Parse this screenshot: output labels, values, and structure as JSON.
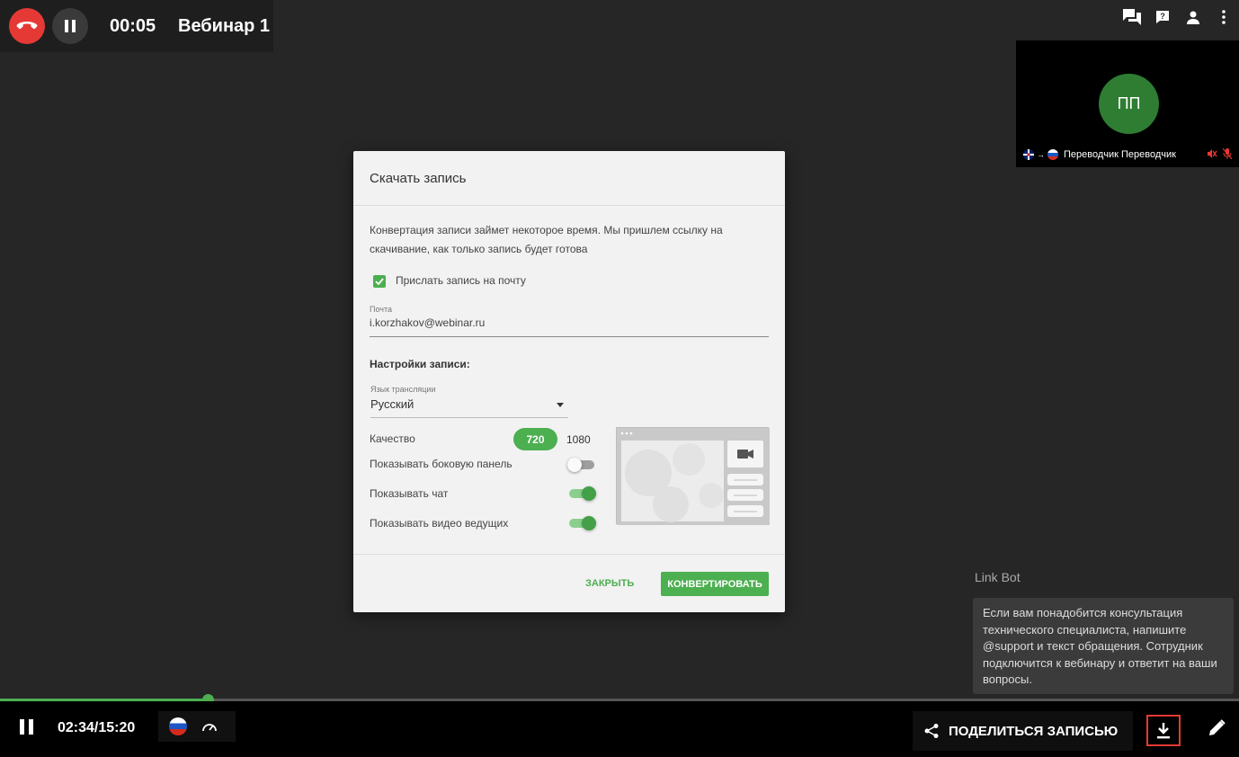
{
  "top_bar": {
    "timer": "00:05",
    "webinar_title": "Вебинар 1"
  },
  "participant_tile": {
    "initials": "ПП",
    "name": "Переводчик Переводчик",
    "lang_from": "en",
    "lang_to": "ru",
    "icon_names": [
      "speaker-muted-icon",
      "mic-muted-icon"
    ]
  },
  "dialog": {
    "title": "Скачать запись",
    "description": "Конвертация записи займет некоторое время. Мы пришлем ссылку на скачивание, как только запись будет готова",
    "send_email_label": "Прислать запись на почту",
    "send_email_checked": true,
    "email_label": "Почта",
    "email_value": "i.korzhakov@webinar.ru",
    "settings_title": "Настройки записи:",
    "language_label": "Язык трансляции",
    "language_value": "Русский",
    "quality_label": "Качество",
    "quality_options": [
      "720",
      "1080"
    ],
    "quality_selected": "720",
    "toggles": [
      {
        "label": "Показывать боковую панель",
        "on": false
      },
      {
        "label": "Показывать чат",
        "on": true
      },
      {
        "label": "Показывать видео ведущих",
        "on": true
      }
    ],
    "close_label": "ЗАКРЫТЬ",
    "convert_label": "КОНВЕРТИРОВАТЬ"
  },
  "chat": {
    "bot_name": "Link Bot",
    "message": "Если вам понадобится консультация технического специалиста, напишите @support и текст обращения. Сотрудник подключится к вебинару и ответит на ваши вопросы."
  },
  "player": {
    "time": "02:34/15:20",
    "progress": 0.1678,
    "share_label": "ПОДЕЛИТЬСЯ ЗАПИСЬЮ"
  },
  "colors": {
    "accent": "#4caf50",
    "hangup": "#e53935",
    "background": "#262626"
  }
}
